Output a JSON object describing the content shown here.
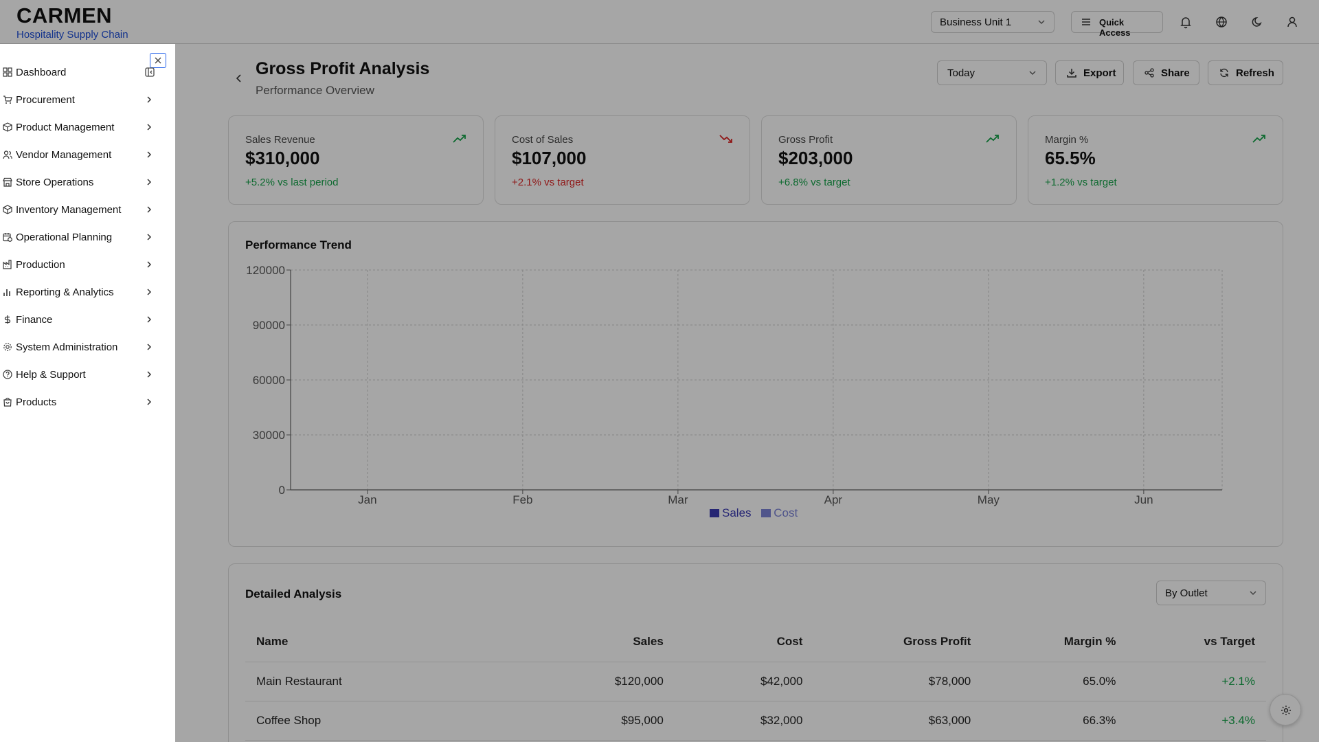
{
  "brand": {
    "title": "CARMEN",
    "subtitle": "Hospitality Supply Chain"
  },
  "topbar": {
    "business_unit": "Business Unit 1",
    "quick_access": "Quick Access"
  },
  "sidebar": {
    "items": [
      {
        "label": "Dashboard",
        "icon": "dashboard-icon"
      },
      {
        "label": "Procurement",
        "icon": "cart-icon"
      },
      {
        "label": "Product Management",
        "icon": "package-icon"
      },
      {
        "label": "Vendor Management",
        "icon": "users-icon"
      },
      {
        "label": "Store Operations",
        "icon": "store-icon"
      },
      {
        "label": "Inventory Management",
        "icon": "box-icon"
      },
      {
        "label": "Operational Planning",
        "icon": "calendar-clock-icon"
      },
      {
        "label": "Production",
        "icon": "factory-icon"
      },
      {
        "label": "Reporting & Analytics",
        "icon": "bar-chart-icon"
      },
      {
        "label": "Finance",
        "icon": "dollar-icon"
      },
      {
        "label": "System Administration",
        "icon": "gear-icon"
      },
      {
        "label": "Help & Support",
        "icon": "help-circle-icon"
      },
      {
        "label": "Products",
        "icon": "shopping-bag-icon"
      }
    ]
  },
  "page": {
    "title": "Gross Profit Analysis",
    "subtitle": "Performance Overview",
    "period": "Today",
    "export_label": "Export",
    "share_label": "Share",
    "refresh_label": "Refresh"
  },
  "kpis": [
    {
      "label": "Sales Revenue",
      "value": "$310,000",
      "delta": "+5.2% vs last period",
      "status": "positive"
    },
    {
      "label": "Cost of Sales",
      "value": "$107,000",
      "delta": "+2.1% vs target",
      "status": "negative"
    },
    {
      "label": "Gross Profit",
      "value": "$203,000",
      "delta": "+6.8% vs target",
      "status": "positive"
    },
    {
      "label": "Margin %",
      "value": "65.5%",
      "delta": "+1.2% vs target",
      "status": "positive"
    }
  ],
  "trend": {
    "title": "Performance Trend"
  },
  "chart_data": {
    "type": "bar",
    "categories": [
      "Jan",
      "Feb",
      "Mar",
      "Apr",
      "May",
      "Jun"
    ],
    "series": [
      {
        "name": "Sales",
        "values": [],
        "color": "#3b3bb3"
      },
      {
        "name": "Cost",
        "values": [],
        "color": "#7b83d6"
      }
    ],
    "yticks": [
      "0",
      "30000",
      "60000",
      "90000",
      "120000"
    ],
    "ylim": [
      0,
      120000
    ],
    "grid": true,
    "legend": "bottom"
  },
  "analysis": {
    "title": "Detailed Analysis",
    "group_by": "By Outlet",
    "columns": [
      "Name",
      "Sales",
      "Cost",
      "Gross Profit",
      "Margin %",
      "vs Target"
    ],
    "rows": [
      [
        "Main Restaurant",
        "$120,000",
        "$42,000",
        "$78,000",
        "65.0%",
        "+2.1%"
      ],
      [
        "Coffee Shop",
        "$95,000",
        "$32,000",
        "$63,000",
        "66.3%",
        "+3.4%"
      ]
    ]
  },
  "colors": {
    "positive": "#16a34a",
    "negative": "#dc2626",
    "accent": "#2563eb"
  }
}
